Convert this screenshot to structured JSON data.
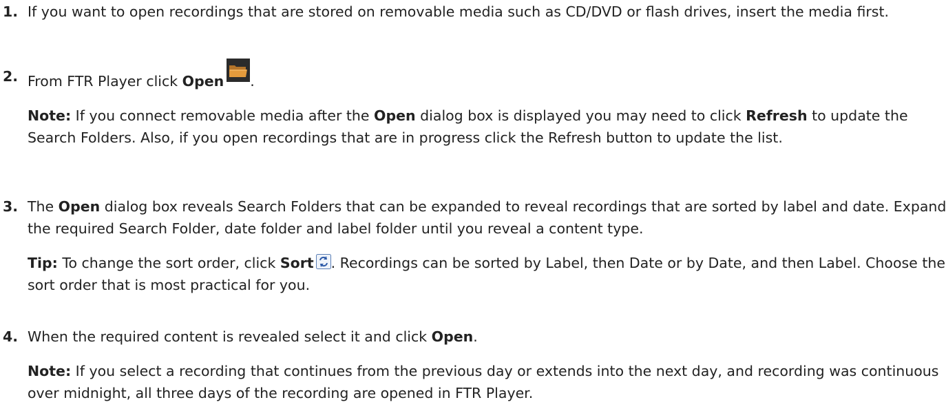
{
  "steps": [
    {
      "number": "1.",
      "text": "If you want to open recordings that are stored on removable media such as CD/DVD or flash drives, insert the media first."
    },
    {
      "number": "2.",
      "text_before": "From FTR Player click ",
      "bold": "Open",
      "icon": "folder-open-icon",
      "text_after": ".",
      "note": {
        "label": "Note:",
        "p1": "  If you connect removable media after the ",
        "b1": "Open",
        "p2": " dialog box is displayed you may need to click ",
        "b2": "Refresh",
        "p3": " to update the Search Folders.  Also, if you open recordings that are in progress click the Refresh button to update the list."
      }
    },
    {
      "number": "3.",
      "text_before": "The ",
      "bold": "Open",
      "text_after": " dialog box reveals Search Folders that can be expanded to reveal recordings that are sorted by label and date.  Expand the required Search Folder, date folder and label folder until you reveal a content type.",
      "tip": {
        "label": "Tip:",
        "p1": "  To change the sort order, click ",
        "b1": "Sort",
        "icon": "sort-refresh-icon",
        "p2": ".  Recordings can be sorted by Label, then Date or by Date, and then Label.  Choose the sort order that is most practical for you."
      }
    },
    {
      "number": "4.",
      "text_before": "When the required content is revealed select it and click ",
      "bold": "Open",
      "text_after": ".",
      "note": {
        "label": "Note:",
        "p1": "  If you select a recording that continues from the previous day or extends into the next day, and recording was continuous over midnight, all three days of the recording are opened in FTR Player."
      }
    }
  ]
}
